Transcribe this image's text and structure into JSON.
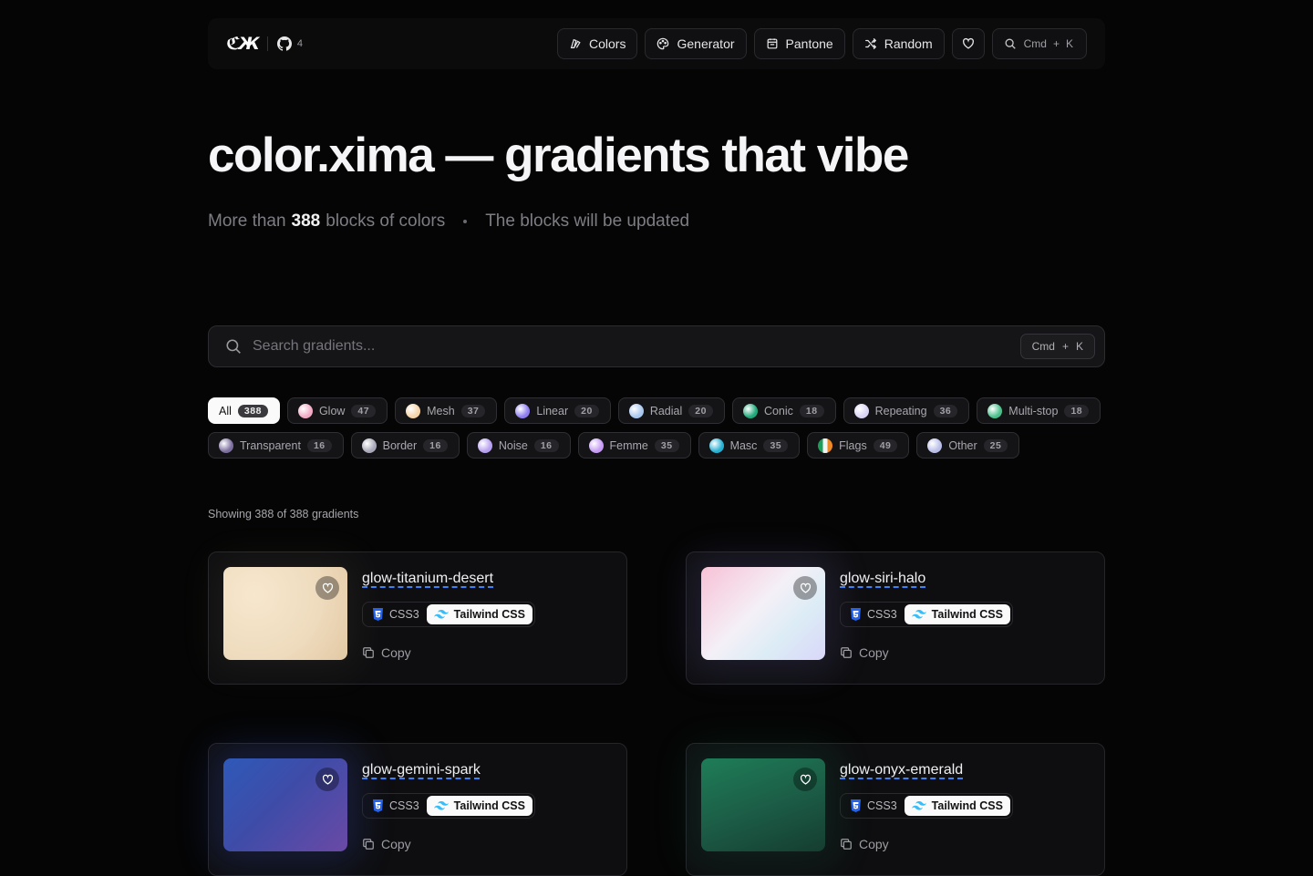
{
  "header": {
    "logo": "ℭЖ",
    "github_count": "4",
    "nav": [
      {
        "label": "Colors",
        "icon": "swatch-icon"
      },
      {
        "label": "Generator",
        "icon": "palette-icon"
      },
      {
        "label": "Pantone",
        "icon": "calendar-icon"
      },
      {
        "label": "Random",
        "icon": "shuffle-icon"
      }
    ],
    "search_kbd": {
      "mod": "Cmd",
      "plus": "+",
      "key": "K"
    }
  },
  "hero": {
    "title": "color.xima — gradients that vibe",
    "sub_prefix": "More than",
    "block_count": "388",
    "sub_suffix": "blocks of colors",
    "sub_right": "The blocks will be updated"
  },
  "search": {
    "placeholder": "Search gradients...",
    "kbd": {
      "mod": "Cmd",
      "plus": "+",
      "key": "K"
    }
  },
  "filters": [
    {
      "label": "All",
      "count": "388",
      "active": true
    },
    {
      "label": "Glow",
      "count": "47",
      "swatch": "#f3a9c4"
    },
    {
      "label": "Mesh",
      "count": "37",
      "swatch": "#f6d3a8"
    },
    {
      "label": "Linear",
      "count": "20",
      "swatch": "#8e7df0"
    },
    {
      "label": "Radial",
      "count": "20",
      "swatch": "#a8c8f0"
    },
    {
      "label": "Conic",
      "count": "18",
      "swatch": "#1fa87a"
    },
    {
      "label": "Repeating",
      "count": "36",
      "swatch": "#d9d4f5"
    },
    {
      "label": "Multi-stop",
      "count": "18",
      "swatch": "#49c08a"
    },
    {
      "label": "Transparent",
      "count": "16",
      "swatch": "#7b6e9e"
    },
    {
      "label": "Border",
      "count": "16",
      "swatch": "#a7a7b8"
    },
    {
      "label": "Noise",
      "count": "16",
      "swatch": "#b69ff0"
    },
    {
      "label": "Femme",
      "count": "35",
      "swatch": "#c69af5"
    },
    {
      "label": "Masc",
      "count": "35",
      "swatch": "#25b0d3"
    },
    {
      "label": "Flags",
      "count": "49",
      "swatch": "flag"
    },
    {
      "label": "Other",
      "count": "25",
      "swatch": "#b8bee8"
    }
  ],
  "showing": "Showing 388 of 388 gradients",
  "cards": [
    {
      "title": "glow-titanium-desert",
      "css": "CSS3",
      "tw": "Tailwind CSS",
      "copy": "Copy",
      "grad": "radial-gradient(circle at 25% 30%, #f7e7cd 0%, #efdcbf 55%, #e3c9a4 100%)",
      "glow": "rgba(240,210,170,0.06)"
    },
    {
      "title": "glow-siri-halo",
      "css": "CSS3",
      "tw": "Tailwind CSS",
      "copy": "Copy",
      "grad": "linear-gradient(135deg, #f7c2d6 0%, #f4f0f7 45%, #dcecf6 70%, #d9d7f9 100%)",
      "glow": "rgba(150,140,255,0.12)"
    },
    {
      "title": "glow-gemini-spark",
      "css": "CSS3",
      "tw": "Tailwind CSS",
      "copy": "Copy",
      "grad": "linear-gradient(135deg, #2f59b8 0%, #3e4ca8 45%, #6a4aa6 100%)",
      "glow": "rgba(60,90,220,0.2)"
    },
    {
      "title": "glow-onyx-emerald",
      "css": "CSS3",
      "tw": "Tailwind CSS",
      "copy": "Copy",
      "grad": "linear-gradient(160deg, #1e7d58 0%, #1c5e47 50%, #153d30 100%)",
      "glow": "rgba(30,140,100,0.15)"
    }
  ]
}
